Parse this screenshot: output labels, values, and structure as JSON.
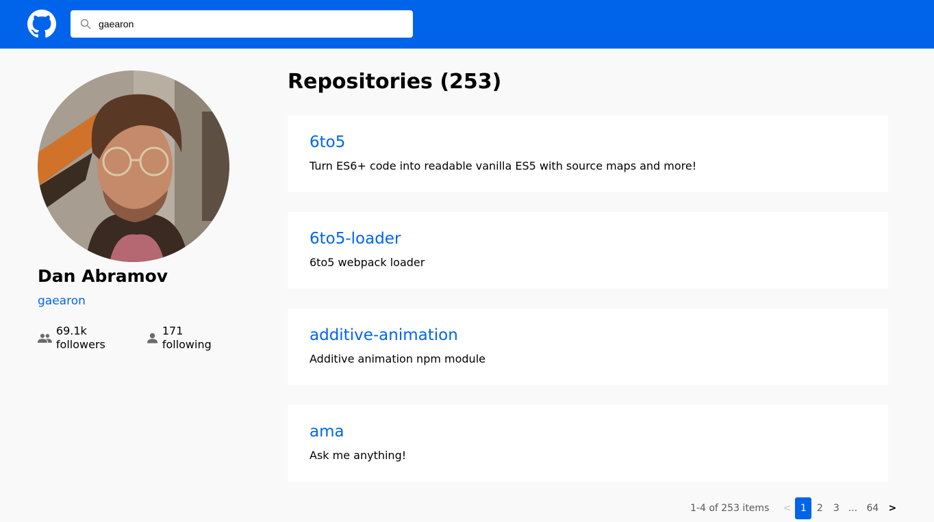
{
  "search": {
    "value": "gaearon"
  },
  "profile": {
    "name": "Dan Abramov",
    "login": "gaearon",
    "followers": "69.1k followers",
    "following": "171 following"
  },
  "repos": {
    "title": "Repositories (253)",
    "items": [
      {
        "name": "6to5",
        "description": "Turn ES6+ code into readable vanilla ES5 with source maps and more!"
      },
      {
        "name": "6to5-loader",
        "description": "6to5 webpack loader"
      },
      {
        "name": "additive-animation",
        "description": "Additive animation npm module"
      },
      {
        "name": "ama",
        "description": "Ask me anything!"
      }
    ]
  },
  "pagination": {
    "total": "1-4 of 253 items",
    "prev": "<",
    "pages": [
      "1",
      "2",
      "3",
      "...",
      "64"
    ],
    "next": ">",
    "current": "1"
  },
  "colors": {
    "header": "#0064eb",
    "link": "#0064eb",
    "background": "#f9f9f9"
  },
  "icons": {
    "logo": "github-logo-icon",
    "search": "search-icon",
    "followers": "people-icon",
    "following": "person-icon"
  }
}
